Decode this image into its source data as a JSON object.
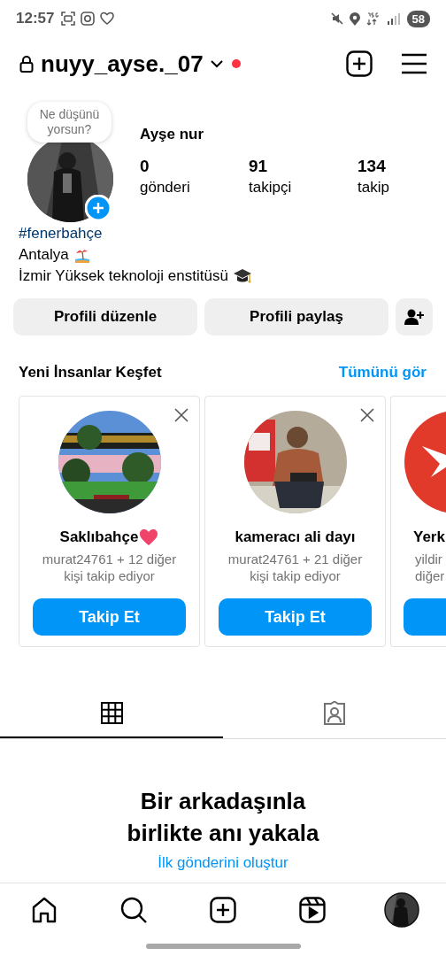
{
  "status_bar": {
    "time": "12:57",
    "battery": "58"
  },
  "header": {
    "username": "nuyy_ayse._07",
    "notification": true
  },
  "profile": {
    "note": "Ne düşünüyorsun?",
    "name": "Ayşe nur",
    "stats": [
      {
        "value": "0",
        "label": "gönderi"
      },
      {
        "value": "91",
        "label": "takipçi"
      },
      {
        "value": "134",
        "label": "takip"
      }
    ],
    "bio": [
      {
        "kind": "hashtag",
        "text": "#fenerbahçe"
      },
      {
        "kind": "line",
        "text": "Antalya",
        "emoji": {
          "kind": "beach"
        }
      },
      {
        "kind": "line",
        "text": "İzmir Yüksek teknoloji enstitüsü",
        "emoji": {
          "kind": "graduation-cap"
        }
      }
    ]
  },
  "actions": [
    "Profili düzenle",
    "Profili paylaş"
  ],
  "suggestions": {
    "title": "Yeni İnsanlar Keşfet",
    "see_all": "Tümünü gör",
    "cards": [
      {
        "kind": "full",
        "name": "Saklıbahçe",
        "emoji": {
          "kind": "heart"
        },
        "subtitle": "murat24761 + 12 diğer kişi takip ediyor",
        "button": "Takip Et"
      },
      {
        "kind": "full",
        "name": "kameracı ali dayı",
        "subtitle": "murat24761 + 21 diğer kişi takip ediyor",
        "button": "Takip Et"
      },
      {
        "kind": "partial",
        "name": "Yerk",
        "subtitle": "yildir diğer"
      }
    ]
  },
  "tabs": [
    {
      "kind": "grid",
      "selected": true
    },
    {
      "kind": "tagged",
      "selected": false
    }
  ],
  "empty_state": {
    "title": "Bir arkadaşınla birlikte anı yakala",
    "link": "İlk gönderini oluştur"
  },
  "nav": [
    {
      "kind": "home"
    },
    {
      "kind": "search"
    },
    {
      "kind": "create"
    },
    {
      "kind": "reels"
    },
    {
      "kind": "profile"
    }
  ]
}
